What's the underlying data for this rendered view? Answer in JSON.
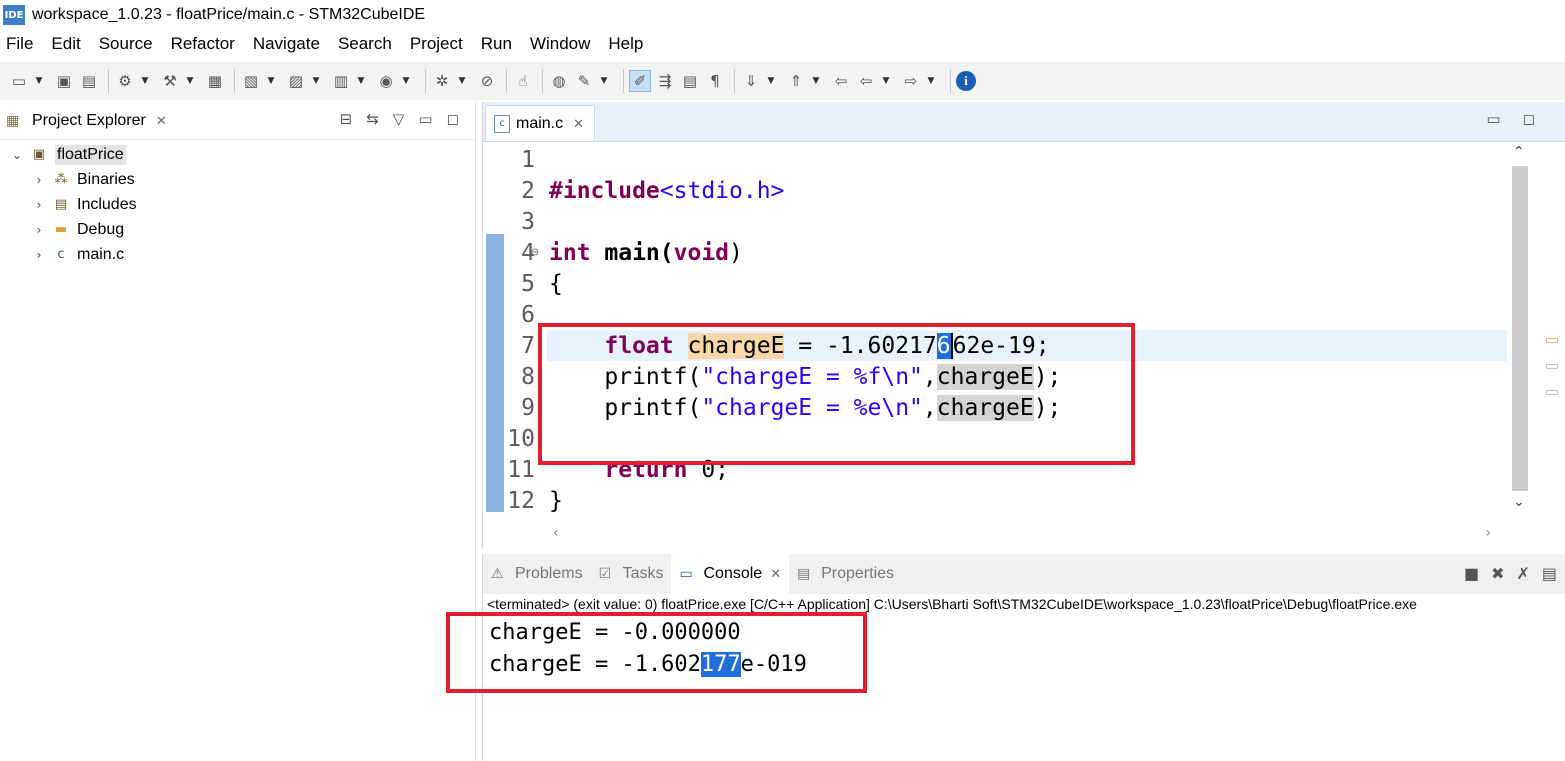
{
  "window": {
    "app_icon": "IDE",
    "title": "workspace_1.0.23 - floatPrice/main.c - STM32CubeIDE"
  },
  "menu": [
    "File",
    "Edit",
    "Source",
    "Refactor",
    "Navigate",
    "Search",
    "Project",
    "Run",
    "Window",
    "Help"
  ],
  "project_explorer": {
    "tab_label": "Project Explorer",
    "root": "floatPrice",
    "children": [
      "Binaries",
      "Includes",
      "Debug",
      "main.c"
    ]
  },
  "editor": {
    "tab_label": "main.c",
    "line_numbers": [
      "1",
      "2",
      "3",
      "4",
      "5",
      "6",
      "7",
      "8",
      "9",
      "10",
      "11",
      "12"
    ],
    "lines": {
      "l2_directive": "#include",
      "l2_file": "<stdio.h>",
      "l4_kw_int": "int",
      "l4_main": " main(",
      "l4_kw_void": "void",
      "l4_close": ")",
      "l5": "{",
      "l7_indent": "    ",
      "l7_kw": "float",
      "l7_space": " ",
      "l7_var": "chargeE",
      "l7_eq": " = -1.60217",
      "l7_sel": "6",
      "l7_rest": "62e-19;",
      "l8_indent": "    ",
      "l8_fn": "printf(",
      "l8_str": "\"chargeE = %f\\n\"",
      "l8_comma": ",",
      "l8_var": "chargeE",
      "l8_end": ");",
      "l9_indent": "    ",
      "l9_fn": "printf(",
      "l9_str": "\"chargeE = %e\\n\"",
      "l9_comma": ",",
      "l9_var": "chargeE",
      "l9_end": ");",
      "l11_indent": "    ",
      "l11_kw": "return",
      "l11_rest": " 0;",
      "l12": "}"
    }
  },
  "console": {
    "tabs": [
      "Problems",
      "Tasks",
      "Console",
      "Properties"
    ],
    "active_tab": "Console",
    "status": "<terminated> (exit value: 0) floatPrice.exe [C/C++ Application] C:\\Users\\Bharti Soft\\STM32CubeIDE\\workspace_1.0.23\\floatPrice\\Debug\\floatPrice.exe",
    "output_line1": "chargeE = -0.000000",
    "output_line2_pre": "chargeE = -1.602",
    "output_line2_sel": "177",
    "output_line2_post": "e-019"
  },
  "colors": {
    "annotation_box": "#e0202c",
    "selection": "#1e6fd9",
    "keyword": "#7f0055",
    "string": "#2a00ff"
  }
}
